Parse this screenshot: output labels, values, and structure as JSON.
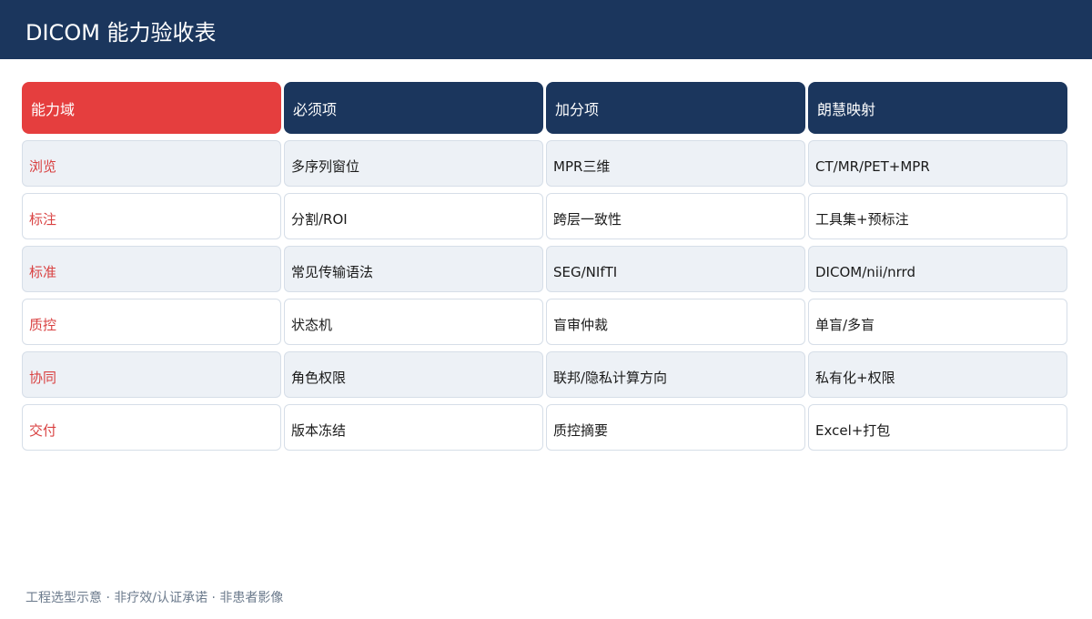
{
  "header": {
    "title": "DICOM 能力验收表"
  },
  "table": {
    "columns": [
      "能力域",
      "必须项",
      "加分项",
      "朗慧映射"
    ],
    "rows": [
      [
        "浏览",
        "多序列窗位",
        "MPR三维",
        "CT/MR/PET+MPR"
      ],
      [
        "标注",
        "分割/ROI",
        "跨层一致性",
        "工具集+预标注"
      ],
      [
        "标准",
        "常见传输语法",
        "SEG/NIfTI",
        "DICOM/nii/nrrd"
      ],
      [
        "质控",
        "状态机",
        "盲审仲裁",
        "单盲/多盲"
      ],
      [
        "协同",
        "角色权限",
        "联邦/隐私计算方向",
        "私有化+权限"
      ],
      [
        "交付",
        "版本冻结",
        "质控摘要",
        "Excel+打包"
      ]
    ]
  },
  "footer": {
    "note": "工程选型示意 · 非疗效/认证承诺 · 非患者影像"
  },
  "colors": {
    "header_bg": "#1b365d",
    "accent_red": "#e53e3e",
    "domain_text": "#d94141",
    "shaded_row": "#edf1f6"
  }
}
